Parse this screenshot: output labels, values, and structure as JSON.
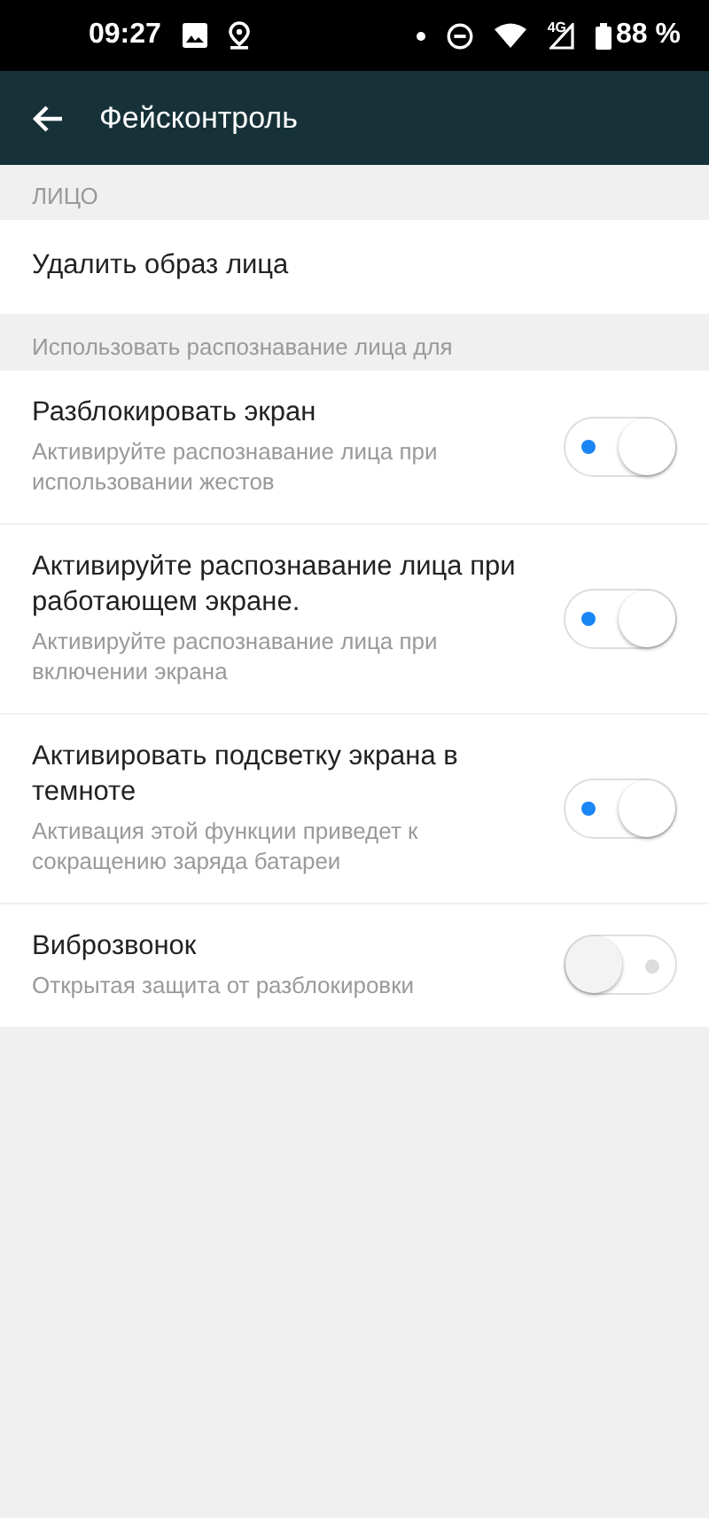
{
  "status_bar": {
    "time": "09:27",
    "battery": "88 %",
    "network": "4G"
  },
  "app_bar": {
    "title": "Фейсконтроль"
  },
  "sections": [
    {
      "header": "ЛИЦО",
      "items": [
        {
          "kind": "action",
          "title": "Удалить образ лица"
        }
      ]
    },
    {
      "header": "Использовать распознавание лица для",
      "items": [
        {
          "kind": "switch",
          "title": "Разблокировать экран",
          "subtitle": "Активируйте распознавание лица при использовании жестов",
          "on": true
        },
        {
          "kind": "switch",
          "title": "Активируйте распознавание лица при работающем экране.",
          "subtitle": "Активируйте распознавание лица при включении экрана",
          "on": true
        },
        {
          "kind": "switch",
          "title": "Активировать подсветку экрана в темноте",
          "subtitle": "Активация этой функции приведет к сокращению заряда батареи",
          "on": true
        },
        {
          "kind": "switch",
          "title": "Виброзвонок",
          "subtitle": "Открытая защита от разблокировки",
          "on": false
        }
      ]
    }
  ]
}
